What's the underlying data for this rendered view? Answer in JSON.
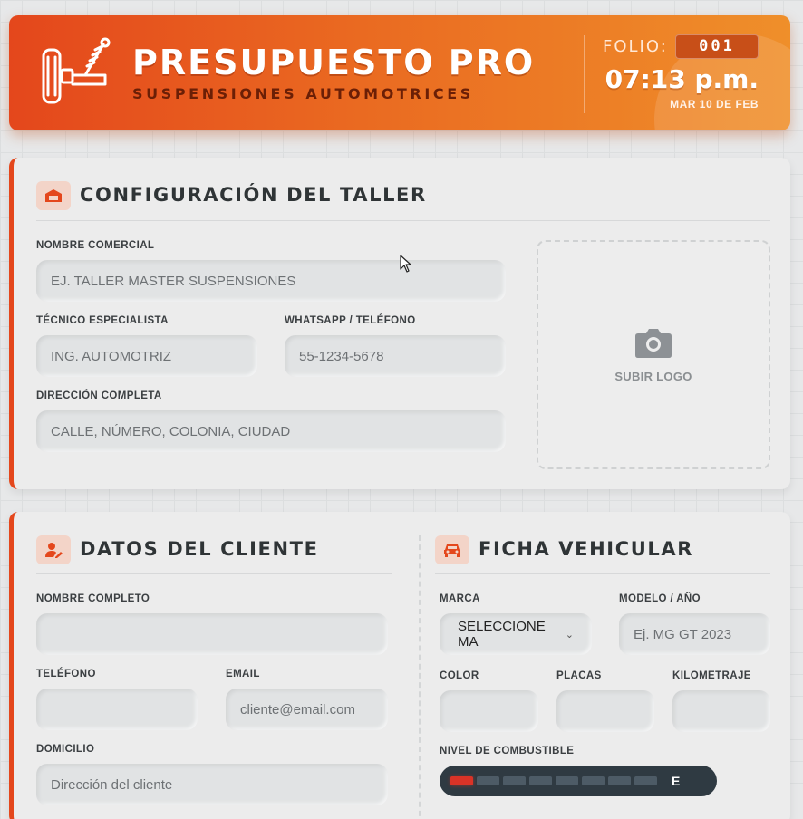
{
  "header": {
    "title": "PRESUPUESTO PRO",
    "subtitle": "SUSPENSIONES AUTOMOTRICES",
    "folio_label": "FOLIO:",
    "folio_value": "001",
    "time": "07:13 p.m.",
    "date": "MAR 10 DE FEB",
    "logo_icon": "suspension-wheel-icon",
    "accent_color": "#e4471c"
  },
  "taller": {
    "title": "CONFIGURACIÓN DEL TALLER",
    "icon": "garage-icon",
    "nombre_label": "NOMBRE COMERCIAL",
    "nombre_placeholder": "EJ. TALLER MASTER SUSPENSIONES",
    "tecnico_label": "TÉCNICO ESPECIALISTA",
    "tecnico_placeholder": "ING. AUTOMOTRIZ",
    "whatsapp_label": "WHATSAPP / TELÉFONO",
    "whatsapp_placeholder": "55-1234-5678",
    "direccion_label": "DIRECCIÓN COMPLETA",
    "direccion_placeholder": "CALLE, NÚMERO, COLONIA, CIUDAD",
    "upload_label": "SUBIR LOGO",
    "upload_icon": "camera-icon"
  },
  "cliente": {
    "title": "DATOS DEL CLIENTE",
    "icon": "user-edit-icon",
    "nombre_label": "NOMBRE COMPLETO",
    "nombre_placeholder": "",
    "telefono_label": "TELÉFONO",
    "telefono_placeholder": "",
    "email_label": "EMAIL",
    "email_placeholder": "cliente@email.com",
    "domicilio_label": "DOMICILIO",
    "domicilio_placeholder": "Dirección del cliente"
  },
  "vehiculo": {
    "title": "FICHA VEHICULAR",
    "icon": "car-icon",
    "marca_label": "MARCA",
    "marca_value": "SELECCIONE MA",
    "modelo_label": "MODELO / AÑO",
    "modelo_placeholder": "Ej. MG GT 2023",
    "color_label": "COLOR",
    "placas_label": "PLACAS",
    "km_label": "KILOMETRAJE",
    "fuel_label": "NIVEL DE COMBUSTIBLE",
    "fuel_level_segments": 1,
    "fuel_total_segments": 8,
    "fuel_end_label": "E",
    "fuel_active_color": "#d93327"
  }
}
